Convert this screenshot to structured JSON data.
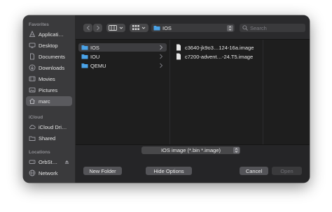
{
  "sidebar": {
    "favorites_title": "Favorites",
    "icloud_title": "iCloud",
    "locations_title": "Locations",
    "favorites": [
      {
        "label": "Applicati…",
        "icon": "applications-icon"
      },
      {
        "label": "Desktop",
        "icon": "desktop-icon"
      },
      {
        "label": "Documents",
        "icon": "document-icon"
      },
      {
        "label": "Downloads",
        "icon": "downloads-icon"
      },
      {
        "label": "Movies",
        "icon": "movies-icon"
      },
      {
        "label": "Pictures",
        "icon": "pictures-icon"
      },
      {
        "label": "marc",
        "icon": "home-icon"
      }
    ],
    "icloud": [
      {
        "label": "iCloud Dri…",
        "icon": "cloud-icon"
      },
      {
        "label": "Shared",
        "icon": "shared-folder-icon"
      }
    ],
    "locations": [
      {
        "label": "OrbSt…",
        "icon": "drive-icon"
      },
      {
        "label": "Network",
        "icon": "network-icon"
      }
    ]
  },
  "toolbar": {
    "current_folder": "IOS",
    "search_placeholder": "Search"
  },
  "columns": {
    "folders": [
      {
        "label": "IOS"
      },
      {
        "label": "IOU"
      },
      {
        "label": "QEMU"
      }
    ],
    "files": [
      {
        "label": "c3640-jk9o3…124-16a.image"
      },
      {
        "label": "c7200-advent…-24.T5.image"
      }
    ]
  },
  "bottom": {
    "format_filter": "IOS image (*.bin *.image)",
    "new_folder_label": "New Folder",
    "hide_options_label": "Hide Options",
    "cancel_label": "Cancel",
    "open_label": "Open"
  },
  "colors": {
    "folder_blue": "#4aa3e8",
    "sidebar_bg": "#3a3a3c",
    "window_bg": "#1e1e1e"
  }
}
